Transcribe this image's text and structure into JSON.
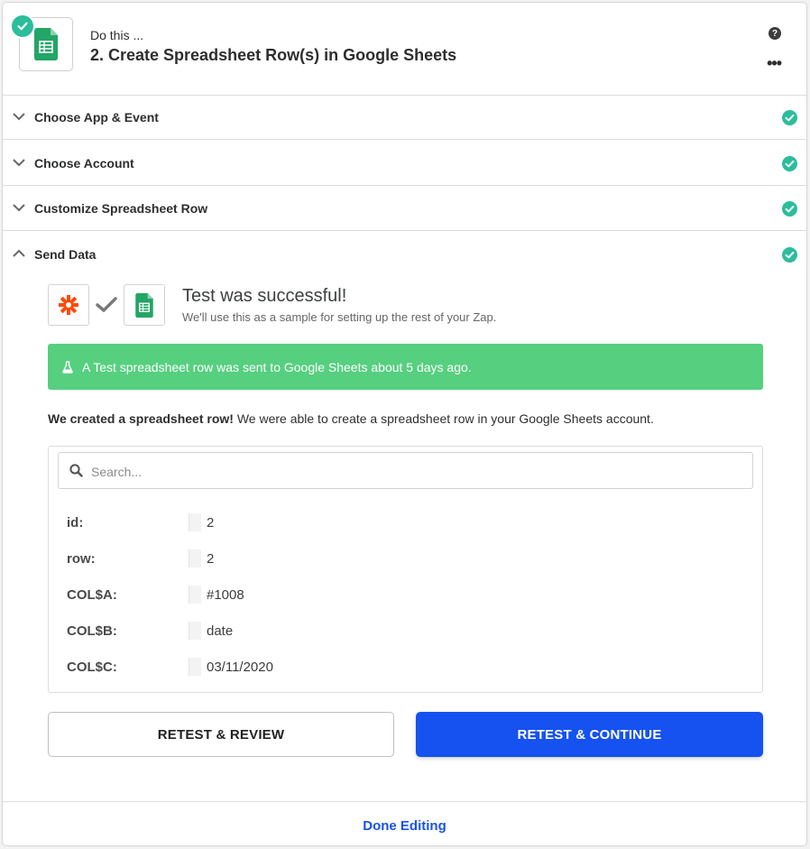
{
  "header": {
    "subtitle": "Do this ...",
    "title": "2. Create Spreadsheet Row(s) in Google Sheets",
    "help_glyph": "?",
    "more_glyph": "•••"
  },
  "sections": [
    {
      "label": "Choose App & Event",
      "status": "complete"
    },
    {
      "label": "Choose Account",
      "status": "complete"
    },
    {
      "label": "Customize Spreadsheet Row",
      "status": "complete"
    }
  ],
  "send_data": {
    "label": "Send Data",
    "test_title": "Test was successful!",
    "test_subtitle": "We'll use this as a sample for setting up the rest of your Zap.",
    "banner": "A Test spreadsheet row was sent to Google Sheets about 5 days ago.",
    "created_bold": "We created a spreadsheet row!",
    "created_rest": " We were able to create a spreadsheet row in your Google Sheets account.",
    "search_placeholder": "Search...",
    "fields": [
      {
        "key": "id:",
        "value": "2"
      },
      {
        "key": "row:",
        "value": "2"
      },
      {
        "key": "COL$A:",
        "value": "#1008"
      },
      {
        "key": "COL$B:",
        "value": "date"
      },
      {
        "key": "COL$C:",
        "value": "03/11/2020"
      }
    ],
    "retest_review": "RETEST & REVIEW",
    "retest_continue": "RETEST & CONTINUE"
  },
  "footer": {
    "done_editing": "Done Editing"
  },
  "colors": {
    "success": "#2bbd9c",
    "banner": "#56cf7f",
    "primary": "#1652f0",
    "sheets_green": "#23a566",
    "zapier_orange": "#ff4a00"
  }
}
